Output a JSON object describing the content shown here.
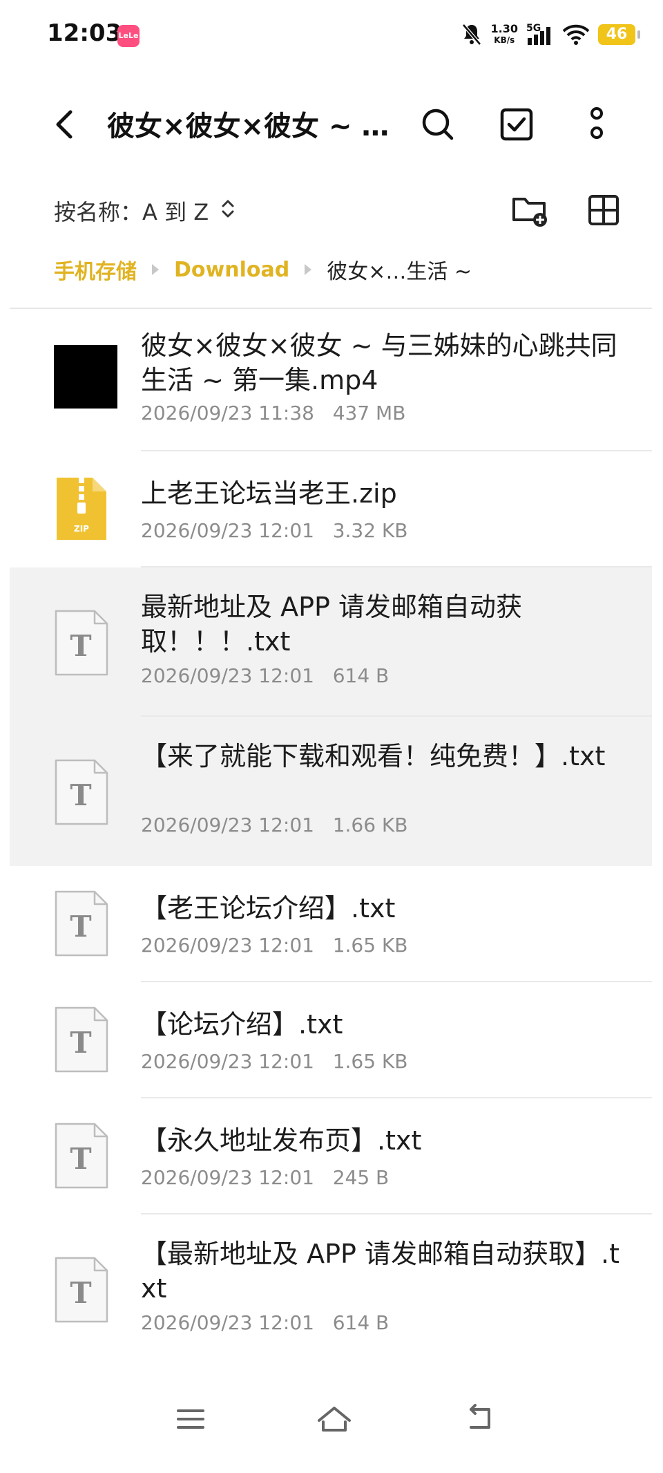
{
  "status_bar": {
    "time": "12:03",
    "app_icon_text": "LeLe",
    "net_speed": "1.30",
    "net_speed_unit": "KB/s",
    "signal_type": "5G",
    "battery": "46"
  },
  "toolbar": {
    "title": "彼女×彼女×彼女 ~ …",
    "icons": [
      "back-icon",
      "search-icon",
      "select-checkbox-icon",
      "more-vertical-icon"
    ]
  },
  "sort": {
    "label": "按名称：",
    "value": "A 到 Z"
  },
  "breadcrumb": {
    "items": [
      "手机存储",
      "Download",
      "彼女×…生活 ~"
    ]
  },
  "files": [
    {
      "name": "彼女×彼女×彼女 ~ 与三姊妹的心跳共同生活 ~ 第一集.mp4",
      "date": "2026/09/23 11:38",
      "size": "437 MB",
      "type": "video",
      "selected": false
    },
    {
      "name": "上老王论坛当老王.zip",
      "date": "2026/09/23 12:01",
      "size": "3.32 KB",
      "type": "zip",
      "selected": false
    },
    {
      "name": "最新地址及 APP 请发邮箱自动获取！！！.txt",
      "date": "2026/09/23 12:01",
      "size": "614 B",
      "type": "txt",
      "selected": true
    },
    {
      "name": "【来了就能下载和观看！纯免费！】.txt",
      "date": "2026/09/23 12:01",
      "size": "1.66 KB",
      "type": "txt",
      "selected": true
    },
    {
      "name": "【老王论坛介绍】.txt",
      "date": "2026/09/23 12:01",
      "size": "1.65 KB",
      "type": "txt",
      "selected": false
    },
    {
      "name": "【论坛介绍】.txt",
      "date": "2026/09/23 12:01",
      "size": "1.65 KB",
      "type": "txt",
      "selected": false
    },
    {
      "name": "【永久地址发布页】.txt",
      "date": "2026/09/23 12:01",
      "size": "245 B",
      "type": "txt",
      "selected": false
    },
    {
      "name": "【最新地址及 APP 请发邮箱自动获取】.txt",
      "date": "2026/09/23 12:01",
      "size": "614 B",
      "type": "txt",
      "selected": false
    }
  ],
  "icon_labels": {
    "zip": "ZIP",
    "txt": "T"
  },
  "colors": {
    "accent": "#e0b321",
    "zip_icon": "#f0c232",
    "selected_row": "#f2f2f2"
  }
}
